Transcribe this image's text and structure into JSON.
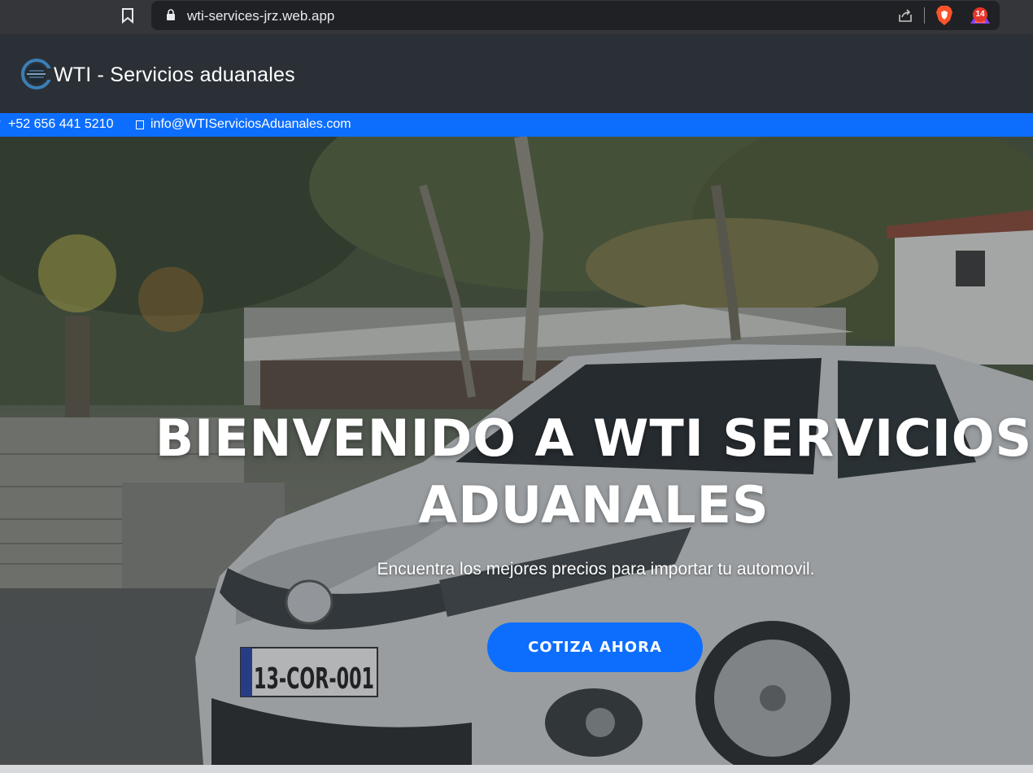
{
  "browser": {
    "url": "wti-services-jrz.web.app",
    "notification_count": "14",
    "icons": [
      "bookmark-icon",
      "lock-icon",
      "share-icon",
      "brave-icon",
      "rewards-icon"
    ]
  },
  "navbar": {
    "brand": "WTI - Servicios aduanales",
    "logo": "wti-logo"
  },
  "topbar": {
    "phone": "+52 656 441 5210",
    "email": "info@WTIServiciosAduanales.com",
    "icons": [
      "phone-icon",
      "envelope-icon"
    ]
  },
  "hero": {
    "title_line1": "BIENVENIDO A WTI SERVICIOS",
    "title_line2": "ADUANALES",
    "subtitle": "Encuentra los mejores precios para importar tu automovil.",
    "cta_label": "COTIZA AHORA",
    "plate_text": "13-COR-001"
  },
  "colors": {
    "accent": "#0d6efd",
    "navbar_bg": "#2b3036",
    "browser_bg": "#35363a"
  }
}
